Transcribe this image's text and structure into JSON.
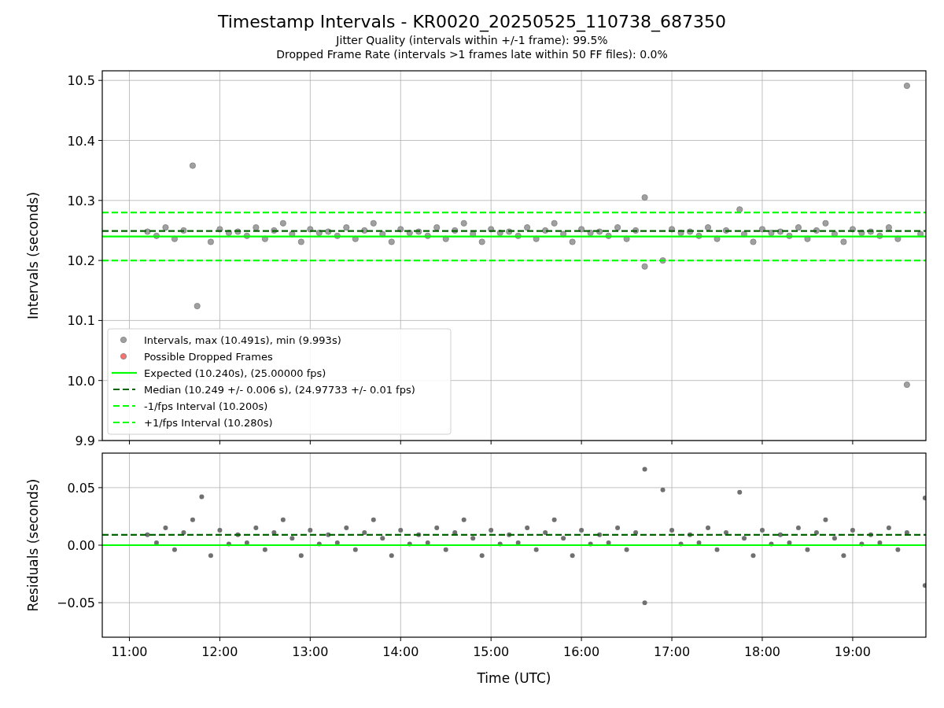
{
  "figure": {
    "title": "Timestamp Intervals - KR0020_20250525_110738_687350",
    "subtitles": [
      "Jitter Quality (intervals within +/-1 frame): 99.5%",
      "Dropped Frame Rate (intervals >1 frames late within 50 FF files): 0.0%"
    ]
  },
  "intervals_plot": {
    "chart_data": {
      "type": "scatter",
      "ylabel": "Intervals (seconds)",
      "grid": true,
      "xlim": [
        10.7,
        19.81
      ],
      "ylim": [
        9.9,
        10.516
      ],
      "yticks": [
        {
          "value": 9.9,
          "label": "9.9"
        },
        {
          "value": 10.0,
          "label": "10.0"
        },
        {
          "value": 10.1,
          "label": "10.1"
        },
        {
          "value": 10.2,
          "label": "10.2"
        },
        {
          "value": 10.3,
          "label": "10.3"
        },
        {
          "value": 10.4,
          "label": "10.4"
        },
        {
          "value": 10.5,
          "label": "10.5"
        }
      ],
      "x": [
        11.2,
        11.3,
        11.4,
        11.5,
        11.6,
        11.7,
        11.75,
        11.9,
        12.0,
        12.1,
        12.2,
        12.3,
        12.4,
        12.5,
        12.6,
        12.7,
        12.8,
        12.9,
        13.0,
        13.1,
        13.2,
        13.3,
        13.4,
        13.5,
        13.6,
        13.7,
        13.8,
        13.9,
        14.0,
        14.1,
        14.2,
        14.3,
        14.4,
        14.5,
        14.6,
        14.7,
        14.8,
        14.9,
        15.0,
        15.1,
        15.2,
        15.3,
        15.4,
        15.5,
        15.6,
        15.7,
        15.8,
        15.9,
        16.0,
        16.1,
        16.2,
        16.3,
        16.4,
        16.5,
        16.6,
        16.7,
        16.7,
        16.9,
        17.0,
        17.1,
        17.2,
        17.3,
        17.4,
        17.5,
        17.6,
        17.75,
        17.8,
        17.9,
        18.0,
        18.1,
        18.2,
        18.3,
        18.4,
        18.5,
        18.6,
        18.7,
        18.8,
        18.9,
        19.0,
        19.1,
        19.2,
        19.3,
        19.4,
        19.5,
        19.6,
        19.6,
        19.75
      ],
      "series": [
        {
          "name": "Intervals, max (10.491s), min (9.993s)",
          "color": "#a0a0a0",
          "values": [
            10.248,
            10.241,
            10.255,
            10.236,
            10.25,
            10.358,
            10.124,
            10.231,
            10.252,
            10.246,
            10.248,
            10.241,
            10.255,
            10.236,
            10.25,
            10.262,
            10.244,
            10.231,
            10.252,
            10.246,
            10.248,
            10.241,
            10.255,
            10.236,
            10.25,
            10.262,
            10.244,
            10.231,
            10.252,
            10.246,
            10.248,
            10.241,
            10.255,
            10.236,
            10.25,
            10.262,
            10.244,
            10.231,
            10.252,
            10.246,
            10.248,
            10.241,
            10.255,
            10.236,
            10.25,
            10.262,
            10.244,
            10.231,
            10.252,
            10.246,
            10.248,
            10.241,
            10.255,
            10.236,
            10.25,
            10.305,
            10.19,
            10.2,
            10.252,
            10.246,
            10.248,
            10.241,
            10.255,
            10.236,
            10.25,
            10.285,
            10.244,
            10.231,
            10.252,
            10.246,
            10.248,
            10.241,
            10.255,
            10.236,
            10.25,
            10.262,
            10.244,
            10.231,
            10.252,
            10.246,
            10.248,
            10.241,
            10.255,
            10.236,
            10.491,
            9.993,
            10.244
          ]
        },
        {
          "name": "Possible Dropped Frames",
          "color": "#ff7070",
          "values": [
            null,
            null,
            null,
            null,
            null,
            null,
            null,
            null,
            null,
            null,
            null,
            null,
            null,
            null,
            null,
            null,
            null,
            null,
            null,
            null,
            null,
            null,
            null,
            null,
            null,
            null,
            null,
            null,
            null,
            null,
            null,
            null,
            null,
            null,
            null,
            null,
            null,
            null,
            null,
            null,
            null,
            null,
            null,
            null,
            null,
            null,
            null,
            null,
            null,
            null,
            null,
            null,
            null,
            null,
            null,
            null,
            null,
            null,
            null,
            null,
            null,
            null,
            null,
            null,
            null,
            null,
            null,
            null,
            null,
            null,
            null,
            null,
            null,
            null,
            null,
            null,
            null,
            null,
            null,
            null,
            null,
            null,
            null,
            null,
            null,
            null,
            null
          ]
        }
      ],
      "ref_lines": [
        {
          "axis": "y",
          "value": 10.24,
          "color": "#00ff00",
          "label": "Expected (10.240s), (25.00000 fps)"
        },
        {
          "axis": "y",
          "value": 10.249,
          "color": "#006400",
          "label": "Median (10.249 +/- 0.006 s), (24.97733 +/- 0.01 fps)"
        },
        {
          "axis": "y",
          "value": 10.2,
          "color": "#00ff00",
          "label": "-1/fps Interval (10.200s)"
        },
        {
          "axis": "y",
          "value": 10.28,
          "color": "#00ff00",
          "label": "+1/fps Interval (10.280s)"
        }
      ],
      "legend": "lower left"
    }
  },
  "residuals_plot": {
    "chart_data": {
      "type": "scatter",
      "xlabel": "Time (UTC)",
      "ylabel": "Residuals (seconds)",
      "grid": true,
      "xlim": [
        10.7,
        19.81
      ],
      "ylim": [
        -0.08,
        0.08
      ],
      "xticks": [
        {
          "value": 11,
          "label": "11:00"
        },
        {
          "value": 12,
          "label": "12:00"
        },
        {
          "value": 13,
          "label": "13:00"
        },
        {
          "value": 14,
          "label": "14:00"
        },
        {
          "value": 15,
          "label": "15:00"
        },
        {
          "value": 16,
          "label": "16:00"
        },
        {
          "value": 17,
          "label": "17:00"
        },
        {
          "value": 18,
          "label": "18:00"
        },
        {
          "value": 19,
          "label": "19:00"
        }
      ],
      "yticks": [
        {
          "value": -0.05,
          "label": "−0.05"
        },
        {
          "value": 0,
          "label": "0.00"
        },
        {
          "value": 0.05,
          "label": "0.05"
        }
      ],
      "x": [
        11.2,
        11.3,
        11.4,
        11.5,
        11.6,
        11.7,
        11.8,
        11.9,
        12.0,
        12.1,
        12.2,
        12.3,
        12.4,
        12.5,
        12.6,
        12.7,
        12.8,
        12.9,
        13.0,
        13.1,
        13.2,
        13.3,
        13.4,
        13.5,
        13.6,
        13.7,
        13.8,
        13.9,
        14.0,
        14.1,
        14.2,
        14.3,
        14.4,
        14.5,
        14.6,
        14.7,
        14.8,
        14.9,
        15.0,
        15.1,
        15.2,
        15.3,
        15.4,
        15.5,
        15.6,
        15.7,
        15.8,
        15.9,
        16.0,
        16.1,
        16.2,
        16.3,
        16.4,
        16.5,
        16.6,
        16.7,
        16.7,
        16.9,
        17.0,
        17.1,
        17.2,
        17.3,
        17.4,
        17.5,
        17.6,
        17.75,
        17.8,
        17.9,
        18.0,
        18.1,
        18.2,
        18.3,
        18.4,
        18.5,
        18.6,
        18.7,
        18.8,
        18.9,
        19.0,
        19.1,
        19.2,
        19.3,
        19.4,
        19.5,
        19.6,
        19.8,
        19.8
      ],
      "series": [
        {
          "color": "#707070",
          "values": [
            0.009,
            0.002,
            0.015,
            -0.004,
            0.011,
            0.022,
            0.042,
            -0.009,
            0.013,
            0.001,
            0.009,
            0.002,
            0.015,
            -0.004,
            0.011,
            0.022,
            0.006,
            -0.009,
            0.013,
            0.001,
            0.009,
            0.002,
            0.015,
            -0.004,
            0.011,
            0.022,
            0.006,
            -0.009,
            0.013,
            0.001,
            0.009,
            0.002,
            0.015,
            -0.004,
            0.011,
            0.022,
            0.006,
            -0.009,
            0.013,
            0.001,
            0.009,
            0.002,
            0.015,
            -0.004,
            0.011,
            0.022,
            0.006,
            -0.009,
            0.013,
            0.001,
            0.009,
            0.002,
            0.015,
            -0.004,
            0.011,
            0.066,
            -0.05,
            0.048,
            0.013,
            0.001,
            0.009,
            0.002,
            0.015,
            -0.004,
            0.011,
            0.046,
            0.006,
            -0.009,
            0.013,
            0.001,
            0.009,
            0.002,
            0.015,
            -0.004,
            0.011,
            0.022,
            0.006,
            -0.009,
            0.013,
            0.001,
            0.009,
            0.002,
            0.015,
            -0.004,
            0.011,
            0.041,
            -0.035
          ]
        }
      ],
      "ref_lines": [
        {
          "axis": "y",
          "value": 0,
          "color": "#00ff00"
        },
        {
          "axis": "y",
          "value": 0.009,
          "color": "#006400"
        }
      ]
    }
  }
}
